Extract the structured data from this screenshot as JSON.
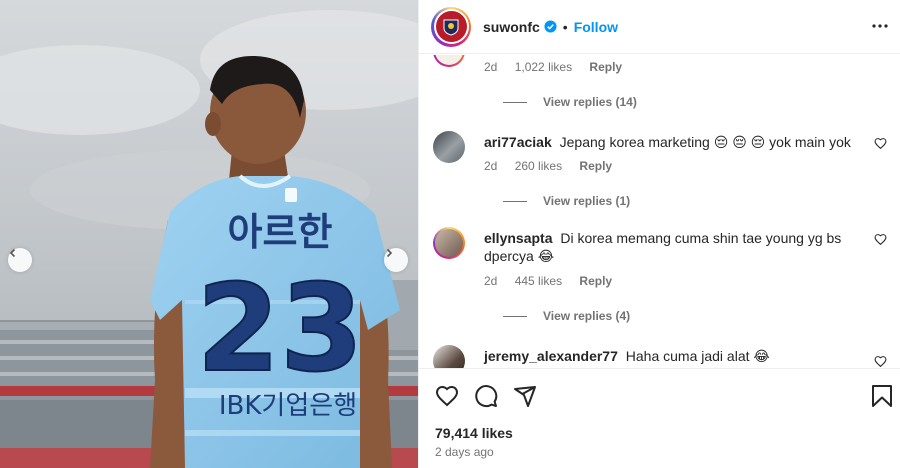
{
  "post": {
    "jersey_name": "아르한",
    "jersey_number": "23",
    "sponsor": "IBK기업은행"
  },
  "header": {
    "username": "suwonfc",
    "separator": "•",
    "follow_label": "Follow"
  },
  "comments": [
    {
      "username": "",
      "text": "",
      "age": "2d",
      "likes": "1,022 likes",
      "reply_label": "Reply",
      "view_replies": "View replies (14)"
    },
    {
      "username": "ari77aciak",
      "text": "Jepang korea marketing 😔 😔 😔 yok main yok",
      "age": "2d",
      "likes": "260 likes",
      "reply_label": "Reply",
      "view_replies": "View replies (1)"
    },
    {
      "username": "ellynsapta",
      "text": "Di korea memang cuma shin tae young yg bs dpercya 😂",
      "age": "2d",
      "likes": "445 likes",
      "reply_label": "Reply",
      "view_replies": "View replies (4)"
    },
    {
      "username": "jeremy_alexander77",
      "text": "Haha cuma jadi alat 😂",
      "age": "",
      "likes": "",
      "reply_label": "",
      "view_replies": ""
    }
  ],
  "footer": {
    "likes": "79,414 likes",
    "date": "2 days ago"
  },
  "icons": {
    "like": "heart-icon",
    "comment": "comment-icon",
    "share": "share-icon",
    "save": "bookmark-icon",
    "more": "more-options-icon",
    "verified": "verified-badge-icon"
  },
  "colors": {
    "follow": "#0095f6",
    "jersey": "#8ec7ec",
    "jersey_numbers": "#1f3d7a",
    "meta_text": "#737373"
  }
}
